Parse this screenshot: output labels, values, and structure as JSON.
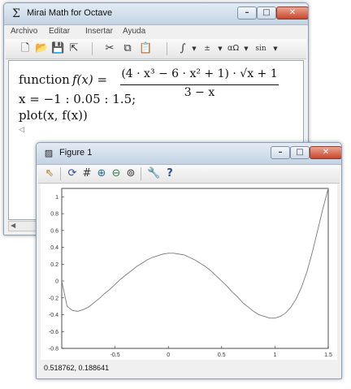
{
  "main_window": {
    "title": "Mirai Math for Octave",
    "title_icon": "sigma-icon",
    "menu": [
      "Archivo",
      "Editar",
      "Insertar",
      "Ayuda"
    ],
    "toolbar_icons": [
      "new-file-icon",
      "open-folder-icon",
      "save-icon",
      "export-icon",
      "cut-icon",
      "copy-icon",
      "paste-icon",
      "integral-icon",
      "fraction-icon",
      "greek-symbol-icon",
      "function-icon"
    ],
    "lines": {
      "function_prefix": "function",
      "function_lhs": "f(x) =",
      "numerator": "(4 · x³ − 6 · x² + 1) · √x + 1",
      "denominator": "3 − x",
      "range": "x = −1 : 0.05 : 1.5;",
      "plot": "plot(x, f(x))"
    }
  },
  "figure_window": {
    "title": "Figure 1",
    "toolbar_icons": [
      "edit-arrow-icon",
      "rotate-icon",
      "grid-icon",
      "zoom-in-icon",
      "zoom-out-icon",
      "zoom-auto-icon",
      "settings-wrench-icon",
      "help-icon"
    ],
    "status": "0.518762,  0.188641"
  },
  "chart_data": {
    "type": "line",
    "title": "",
    "xlabel": "",
    "ylabel": "",
    "xlim": [
      -1,
      1.5
    ],
    "ylim": [
      -0.8,
      1.1
    ],
    "xticks": [
      "-0.5",
      "0",
      "0.5",
      "1",
      "1.5"
    ],
    "yticks": [
      "1",
      "0.8",
      "0.6",
      "0.4",
      "0.2",
      "0",
      "-0.2",
      "-0.4",
      "-0.6",
      "-0.8"
    ],
    "grid": false,
    "colors": {
      "line": "#7a7a7a"
    },
    "series": [
      {
        "x": [
          -1,
          -0.95,
          -0.9,
          -0.85,
          -0.8,
          -0.75,
          -0.7,
          -0.65,
          -0.6,
          -0.55,
          -0.5,
          -0.45,
          -0.4,
          -0.35,
          -0.3,
          -0.25,
          -0.2,
          -0.15,
          -0.1,
          -0.05,
          0,
          0.05,
          0.1,
          0.15,
          0.2,
          0.25,
          0.3,
          0.35,
          0.4,
          0.45,
          0.5,
          0.55,
          0.6,
          0.65,
          0.7,
          0.75,
          0.8,
          0.85,
          0.9,
          0.95,
          1,
          1.05,
          1.1,
          1.15,
          1.2,
          1.25,
          1.3,
          1.35,
          1.4,
          1.45,
          1.5
        ],
        "values": [
          0,
          -0.3,
          -0.35,
          -0.36,
          -0.34,
          -0.31,
          -0.26,
          -0.21,
          -0.15,
          -0.1,
          -0.04,
          0.02,
          0.07,
          0.12,
          0.17,
          0.21,
          0.25,
          0.28,
          0.3,
          0.32,
          0.33,
          0.33,
          0.32,
          0.31,
          0.28,
          0.25,
          0.21,
          0.17,
          0.12,
          0.06,
          0.0,
          -0.06,
          -0.13,
          -0.19,
          -0.26,
          -0.31,
          -0.36,
          -0.4,
          -0.42,
          -0.44,
          -0.44,
          -0.42,
          -0.38,
          -0.31,
          -0.21,
          -0.07,
          0.11,
          0.34,
          0.6,
          0.86,
          1.13
        ]
      }
    ]
  }
}
